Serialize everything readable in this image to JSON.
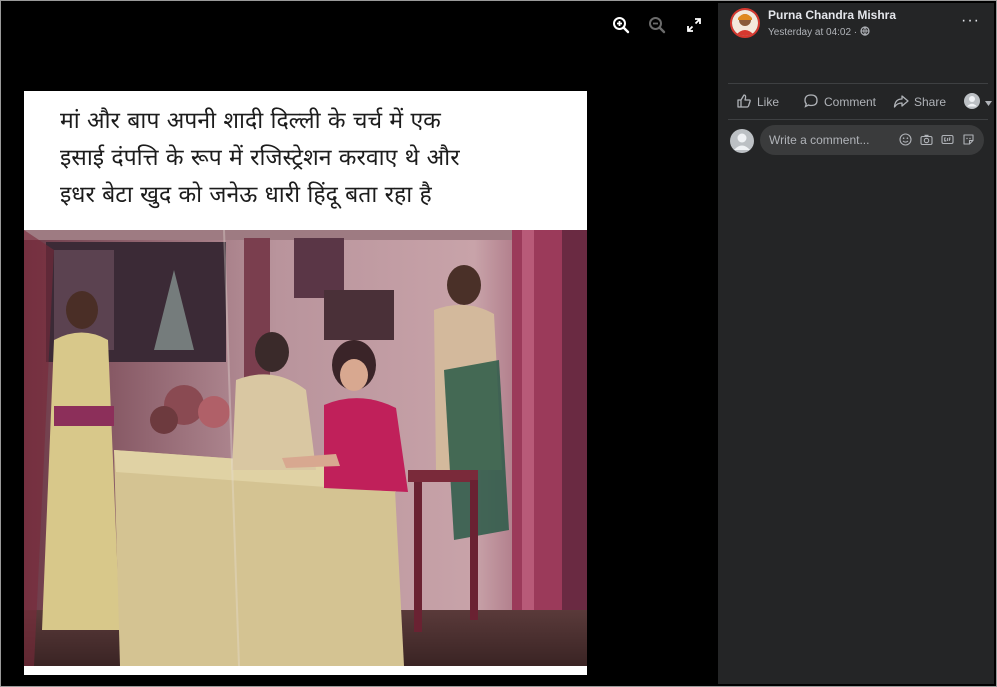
{
  "viewer": {
    "toolbar": [
      {
        "icon": "zoom-in-icon"
      },
      {
        "icon": "zoom-out-icon"
      },
      {
        "icon": "fullscreen-icon"
      }
    ],
    "post_image": {
      "caption_lines": [
        "मां और बाप अपनी शादी दिल्ली के चर्च में एक",
        "इसाई दंपत्ति के रूप में रजिस्ट्रेशन करवाए थे और",
        "इधर बेटा खुद को जनेऊ धारी हिंदू बता रहा है"
      ]
    }
  },
  "sidebar": {
    "author": "Purna Chandra Mishra",
    "timestamp": "Yesterday at 04:02 ·",
    "privacy_icon": "globe-icon",
    "more_icon": "more-options-icon",
    "more_label": "···",
    "actions": {
      "like": "Like",
      "comment": "Comment",
      "share": "Share"
    },
    "comment_box": {
      "placeholder": "Write a comment...",
      "icons": [
        "emoji-icon",
        "camera-icon",
        "gif-icon",
        "sticker-icon"
      ]
    }
  },
  "colors": {
    "viewer_bg": "#000000",
    "sidebar_bg": "#242526",
    "text_primary": "#e4e6eb",
    "text_secondary": "#b0b3b8",
    "input_bg": "#3a3b3c",
    "avatar_ring": "#d6382f"
  }
}
